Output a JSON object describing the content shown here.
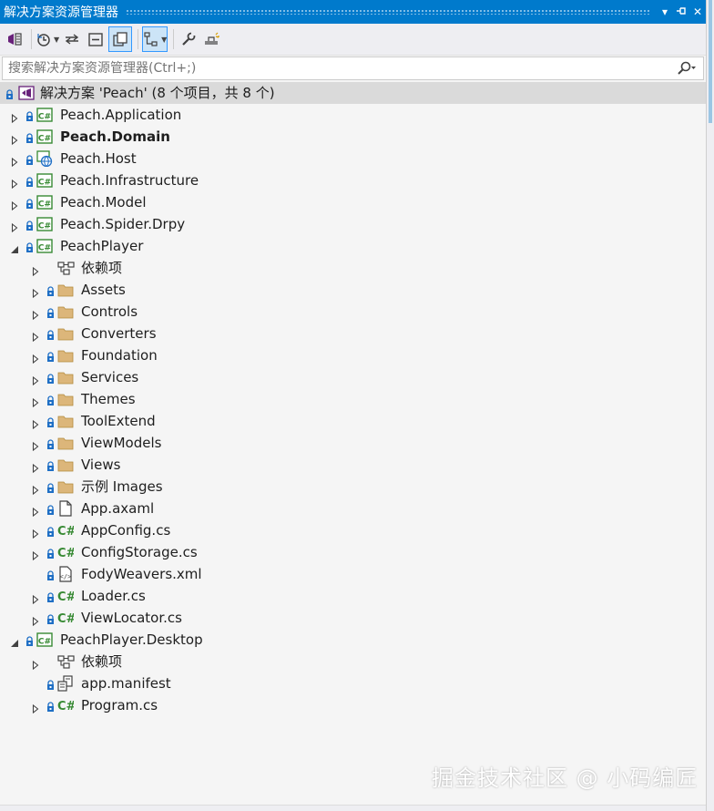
{
  "panel": {
    "title": "解决方案资源管理器",
    "title_buttons": [
      "▾",
      "⊣",
      "✕"
    ]
  },
  "toolbar": {
    "items": [
      "vs-switch-views-icon",
      "history-icon",
      "sync-icon",
      "collapse-all-icon",
      "show-all-files-icon",
      "preview-selected-icon",
      "properties-wrench-icon",
      "pending-changes-icon"
    ]
  },
  "search": {
    "placeholder": "搜索解决方案资源管理器(Ctrl+;)"
  },
  "tree": [
    {
      "label": "解决方案 'Peach' (8 个项目，共 8 个)",
      "level": 0,
      "icon": "solution-icon",
      "exp": "none",
      "lock": true,
      "root": true
    },
    {
      "label": "Peach.Application",
      "level": 1,
      "icon": "csharp-project-icon",
      "exp": "collapsed",
      "lock": true
    },
    {
      "label": "Peach.Domain",
      "level": 1,
      "icon": "csharp-project-icon",
      "exp": "collapsed",
      "lock": true,
      "bold": true
    },
    {
      "label": "Peach.Host",
      "level": 1,
      "icon": "web-project-icon",
      "exp": "collapsed",
      "lock": true
    },
    {
      "label": "Peach.Infrastructure",
      "level": 1,
      "icon": "csharp-project-icon",
      "exp": "collapsed",
      "lock": true
    },
    {
      "label": "Peach.Model",
      "level": 1,
      "icon": "csharp-project-icon",
      "exp": "collapsed",
      "lock": true
    },
    {
      "label": "Peach.Spider.Drpy",
      "level": 1,
      "icon": "csharp-project-icon",
      "exp": "collapsed",
      "lock": true
    },
    {
      "label": "PeachPlayer",
      "level": 1,
      "icon": "csharp-project-icon",
      "exp": "expanded",
      "lock": true
    },
    {
      "label": "依赖项",
      "level": 2,
      "icon": "dependencies-icon",
      "exp": "collapsed",
      "lock": false
    },
    {
      "label": "Assets",
      "level": 2,
      "icon": "folder-icon",
      "exp": "collapsed",
      "lock": true
    },
    {
      "label": "Controls",
      "level": 2,
      "icon": "folder-icon",
      "exp": "collapsed",
      "lock": true
    },
    {
      "label": "Converters",
      "level": 2,
      "icon": "folder-icon",
      "exp": "collapsed",
      "lock": true
    },
    {
      "label": "Foundation",
      "level": 2,
      "icon": "folder-icon",
      "exp": "collapsed",
      "lock": true
    },
    {
      "label": "Services",
      "level": 2,
      "icon": "folder-icon",
      "exp": "collapsed",
      "lock": true
    },
    {
      "label": "Themes",
      "level": 2,
      "icon": "folder-icon",
      "exp": "collapsed",
      "lock": true
    },
    {
      "label": "ToolExtend",
      "level": 2,
      "icon": "folder-icon",
      "exp": "collapsed",
      "lock": true
    },
    {
      "label": "ViewModels",
      "level": 2,
      "icon": "folder-icon",
      "exp": "collapsed",
      "lock": true
    },
    {
      "label": "Views",
      "level": 2,
      "icon": "folder-icon",
      "exp": "collapsed",
      "lock": true
    },
    {
      "label": "示例 Images",
      "level": 2,
      "icon": "folder-icon",
      "exp": "collapsed",
      "lock": true
    },
    {
      "label": "App.axaml",
      "level": 2,
      "icon": "file-icon",
      "exp": "collapsed",
      "lock": true
    },
    {
      "label": "AppConfig.cs",
      "level": 2,
      "icon": "csharp-file-icon",
      "exp": "collapsed",
      "lock": true
    },
    {
      "label": "ConfigStorage.cs",
      "level": 2,
      "icon": "csharp-file-icon",
      "exp": "collapsed",
      "lock": true
    },
    {
      "label": "FodyWeavers.xml",
      "level": 2,
      "icon": "xml-file-icon",
      "exp": "none",
      "lock": true
    },
    {
      "label": "Loader.cs",
      "level": 2,
      "icon": "csharp-file-icon",
      "exp": "collapsed",
      "lock": true
    },
    {
      "label": "ViewLocator.cs",
      "level": 2,
      "icon": "csharp-file-icon",
      "exp": "collapsed",
      "lock": true
    },
    {
      "label": "PeachPlayer.Desktop",
      "level": 1,
      "icon": "csharp-project-icon",
      "exp": "expanded",
      "lock": true
    },
    {
      "label": "依赖项",
      "level": 2,
      "icon": "dependencies-icon",
      "exp": "collapsed",
      "lock": false
    },
    {
      "label": "app.manifest",
      "level": 2,
      "icon": "manifest-file-icon",
      "exp": "none",
      "lock": true
    },
    {
      "label": "Program.cs",
      "level": 2,
      "icon": "csharp-file-icon",
      "exp": "collapsed",
      "lock": true
    }
  ],
  "watermark": "掘金技术社区 @ 小码编匠",
  "colors": {
    "accent": "#007acc",
    "csharp_green": "#388a34",
    "folder": "#dcb67a",
    "lock_blue": "#1f6fc5",
    "selected_row": "#dadada"
  }
}
